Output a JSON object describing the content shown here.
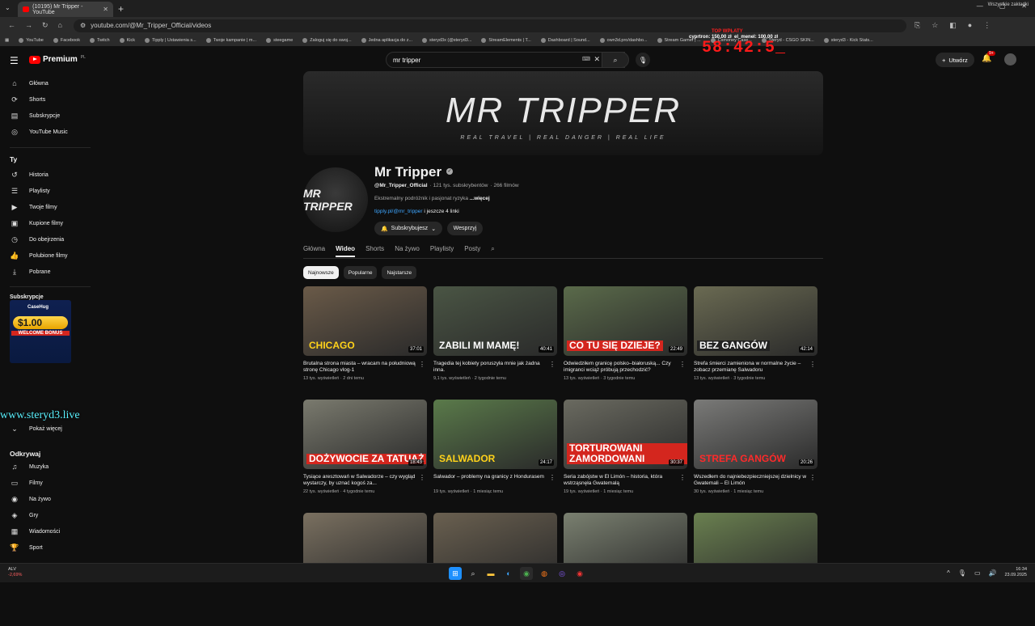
{
  "browser": {
    "tab_title": "(10195) Mr Tripper - YouTube",
    "url": "youtube.com/@Mr_Tripper_Official/videos",
    "bookmarks": [
      "YouTube",
      "Facebook",
      "Twitch",
      "Kick",
      "Tipply | Ustawienia s...",
      "Twoje kampanie | m...",
      "steegame",
      "Zaloguj się do swoj...",
      "Jedna aplikacja do z...",
      "steryd3x (@steryd3...",
      "StreamElements | T...",
      "Dashboard | Sound...",
      "own3d.pro/dashbo...",
      "Stream Gamer | ...",
      "Csmoney Case...",
      "Steryd - CSGO SKIN...",
      "steryd3 - Kick Stats..."
    ],
    "all_bookmarks": "Wszystkie zakładki"
  },
  "overlay": {
    "donate_title": "TOP WPŁATY",
    "donor1": "cyprtron: 150,00 zł",
    "donor2": "el_menel: 100,00 zł",
    "timer": "58:42:5_",
    "stream_url": "www.steryd3.live"
  },
  "header": {
    "logo_text": "Premium",
    "logo_sup": "PL",
    "search_value": "mr tripper",
    "create_label": "Utwórz",
    "notif_badge": "9+"
  },
  "sidebar": {
    "main": [
      {
        "icon": "⌂",
        "label": "Główna"
      },
      {
        "icon": "⟳",
        "label": "Shorts"
      },
      {
        "icon": "▤",
        "label": "Subskrypcje"
      },
      {
        "icon": "◎",
        "label": "YouTube Music"
      }
    ],
    "you_heading": "Ty",
    "you": [
      {
        "icon": "↺",
        "label": "Historia"
      },
      {
        "icon": "☰",
        "label": "Playlisty"
      },
      {
        "icon": "▶",
        "label": "Twoje filmy"
      },
      {
        "icon": "▣",
        "label": "Kupione filmy"
      },
      {
        "icon": "◷",
        "label": "Do obejrzenia"
      },
      {
        "icon": "👍",
        "label": "Polubione filmy"
      },
      {
        "icon": "⤓",
        "label": "Pobrane"
      }
    ],
    "subs_heading": "Subskrypcje",
    "show_more": "Pokaż więcej",
    "explore_heading": "Odkrywaj",
    "explore": [
      {
        "icon": "♫",
        "label": "Muzyka"
      },
      {
        "icon": "▭",
        "label": "Filmy"
      },
      {
        "icon": "◉",
        "label": "Na żywo"
      },
      {
        "icon": "◈",
        "label": "Gry"
      },
      {
        "icon": "▦",
        "label": "Wiadomości"
      },
      {
        "icon": "🏆",
        "label": "Sport"
      }
    ],
    "ad": {
      "brand": "CaseHug",
      "amount": "$1.00",
      "text": "WELCOME BONUS"
    }
  },
  "banner": {
    "title": "MR TRIPPER",
    "subtitle": "REAL TRAVEL | REAL DANGER | REAL LIFE"
  },
  "channel": {
    "avatar_text": "MR TRIPPER",
    "name": "Mr Tripper",
    "handle": "@Mr_Tripper_Official",
    "subs": "· 121 tys. subskrybentów",
    "videos": "· 266 filmów",
    "desc": "Ekstremalny podróżnik i pasjonat ryzyka",
    "more": "...więcej",
    "link": "tipply.pl/@mr_tripper",
    "more_links": "i jeszcze 4 linki",
    "subscribe_label": "Subskrybujesz",
    "support_label": "Wesprzyj"
  },
  "tabs": [
    "Główna",
    "Wideo",
    "Shorts",
    "Na żywo",
    "Playlisty",
    "Posty"
  ],
  "chips": [
    "Najnowsze",
    "Popularne",
    "Najstarsze"
  ],
  "videos": [
    {
      "title": "Brutalna strona miasta – wracam na południową stronę Chicago vlog-1",
      "meta": "13 tys. wyświetleń · 2 dni temu",
      "duration": "37:01",
      "thumb_text": "CHICAGO",
      "color": "#6a5a48",
      "txtcolor": "#ffd21a",
      "txtbg": "transparent"
    },
    {
      "title": "Tragedia tej kobiety poruszyła mnie jak żadna inna.",
      "meta": "9,1 tys. wyświetleń · 2 tygodnie temu",
      "duration": "40:41",
      "thumb_text": "ZABILI MI MAMĘ!",
      "color": "#4a5544",
      "txtcolor": "#ffffff",
      "txtbg": "transparent"
    },
    {
      "title": "Odwiedziłem granicę polsko–białoruską... Czy imigranci wciąż próbują przechodzić?",
      "meta": "13 tys. wyświetleń · 3 tygodnie temu",
      "duration": "22:49",
      "thumb_text": "CO TU SIĘ DZIEJE?",
      "color": "#5a6a4a",
      "txtcolor": "#ffffff",
      "txtbg": "#d4261e"
    },
    {
      "title": "Strefa śmierci zamieniona w normalne życie – zobacz przemianę Salwadoru",
      "meta": "13 tys. wyświetleń · 3 tygodnie temu",
      "duration": "42:14",
      "thumb_text": "BEZ GANGÓW",
      "color": "#6a6a52",
      "txtcolor": "#ffffff",
      "txtbg": "#222222"
    },
    {
      "title": "Tysiące aresztowań w Salwadorze – czy wygląd wystarczy, by uznać kogoś za...",
      "meta": "22 tys. wyświetleń · 4 tygodnie temu",
      "duration": "18:43",
      "thumb_text": "DOŻYWOCIE ZA TATUAŻ",
      "color": "#7a7a6e",
      "txtcolor": "#ffffff",
      "txtbg": "#d4261e"
    },
    {
      "title": "Salwador – problemy na granicy z Hondurasem",
      "meta": "19 tys. wyświetleń · 1 miesiąc temu",
      "duration": "24:17",
      "thumb_text": "SALWADOR",
      "color": "#5a7a4a",
      "txtcolor": "#ffd21a",
      "txtbg": "transparent"
    },
    {
      "title": "Seria zabójstw w El Limón – historia, która wstrząsnęła Gwatemalą",
      "meta": "19 tys. wyświetleń · 1 miesiąc temu",
      "duration": "30:37",
      "thumb_text": "TORTUROWANI ZAMORDOWANI",
      "color": "#6a6a60",
      "txtcolor": "#ffffff",
      "txtbg": "#d4261e"
    },
    {
      "title": "Wszedłem do najniebezpieczniejszej dzielnicy w Gwatemali – El Limón",
      "meta": "30 tys. wyświetleń · 1 miesiąc temu",
      "duration": "20:26",
      "thumb_text": "STREFA GANGÓW",
      "color": "#7a7a78",
      "txtcolor": "#ff2a2a",
      "txtbg": "transparent"
    },
    {
      "title": "",
      "meta": "",
      "duration": "",
      "thumb_text": "",
      "color": "#7a7060",
      "txtcolor": "#fff",
      "txtbg": "transparent"
    },
    {
      "title": "",
      "meta": "",
      "duration": "",
      "thumb_text": "",
      "color": "#6a6050",
      "txtcolor": "#fff",
      "txtbg": "transparent"
    },
    {
      "title": "",
      "meta": "",
      "duration": "",
      "thumb_text": "",
      "color": "#7a8070",
      "txtcolor": "#fff",
      "txtbg": "transparent"
    },
    {
      "title": "",
      "meta": "",
      "duration": "",
      "thumb_text": "",
      "color": "#6a8050",
      "txtcolor": "#fff",
      "txtbg": "transparent"
    }
  ],
  "taskbar": {
    "weather1": "ALV",
    "weather2": "-2,69%",
    "time": "16:34",
    "date": "23.09.2025"
  },
  "colors": {
    "accent": "#ff0000",
    "link": "#3ea6ff",
    "bg": "#0f0f0f"
  }
}
